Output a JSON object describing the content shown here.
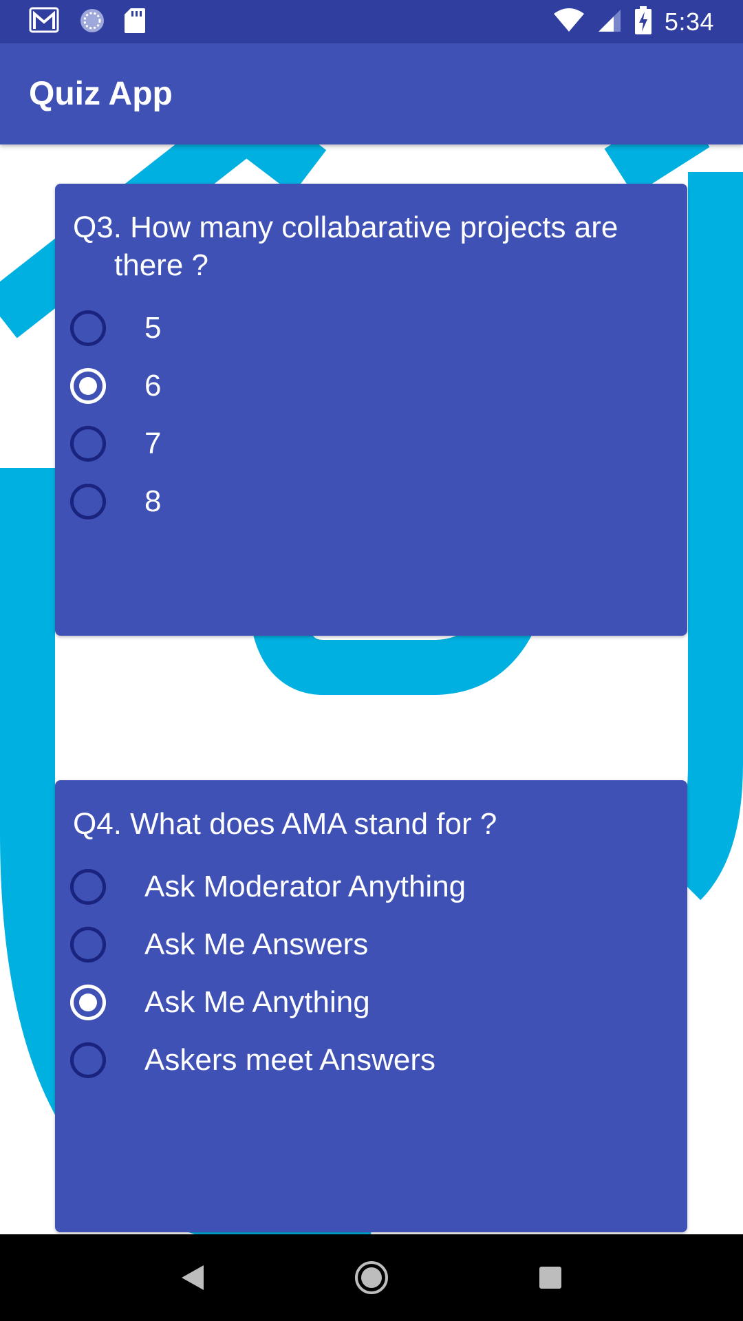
{
  "status_bar": {
    "time": "5:34",
    "icons": [
      "gmail-icon",
      "sync-icon",
      "sd-card-icon",
      "wifi-icon",
      "signal-icon",
      "battery-charging-icon"
    ]
  },
  "app_bar": {
    "title": "Quiz App"
  },
  "questions": [
    {
      "text": "Q3. How many collabarative projects are there ?",
      "options": [
        "5",
        "6",
        "7",
        "8"
      ],
      "selected": "6"
    },
    {
      "text": "Q4. What does AMA stand for ?",
      "options": [
        "Ask Moderator Anything",
        "Ask Me Answers",
        "Ask Me Anything",
        "Askers meet Answers"
      ],
      "selected": "Ask Me Anything"
    }
  ],
  "nav_bar": {
    "icons": [
      "back-icon",
      "home-icon",
      "recents-icon"
    ]
  },
  "colors": {
    "status_bar": "#303f9f",
    "primary": "#3f51b5",
    "radio_unchecked": "#1a237e",
    "radio_checked": "#ffffff",
    "background_art": "#00b0e0"
  }
}
